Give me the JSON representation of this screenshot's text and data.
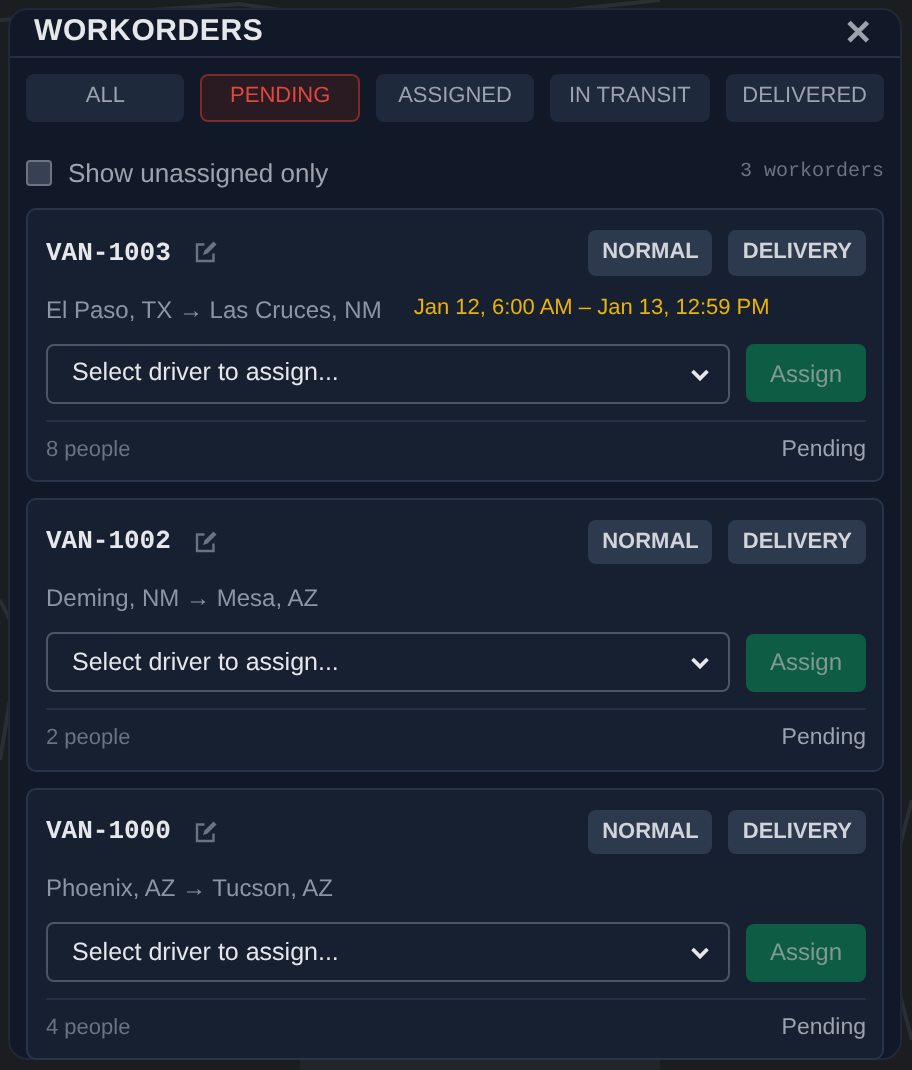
{
  "title": "WORKORDERS",
  "close": "✕",
  "tabs": [
    {
      "label": "ALL",
      "selected": false
    },
    {
      "label": "PENDING",
      "selected": true
    },
    {
      "label": "ASSIGNED",
      "selected": false
    },
    {
      "label": "IN TRANSIT",
      "selected": false
    },
    {
      "label": "DELIVERED",
      "selected": false
    }
  ],
  "filter": {
    "label": "Show unassigned only",
    "checked": false
  },
  "count": "3 workorders",
  "workorders": [
    {
      "id": "VAN-1003",
      "tags": [
        "NORMAL",
        "DELIVERY"
      ],
      "route": "El Paso, TX → Las Cruces, NM",
      "window": "Jan 12, 6:00 AM – Jan 13, 12:59 PM",
      "driver_placeholder": "Select driver to assign...",
      "assign": {
        "label": "Assign",
        "disabled": true
      },
      "people": "8 people",
      "status": "Pending"
    },
    {
      "id": "VAN-1002",
      "tags": [
        "NORMAL",
        "DELIVERY"
      ],
      "route": "Deming, NM → Mesa, AZ",
      "driver_placeholder": "Select driver to assign...",
      "assign": {
        "label": "Assign",
        "disabled": true
      },
      "people": "2 people",
      "status": "Pending"
    },
    {
      "id": "VAN-1000",
      "tags": [
        "NORMAL",
        "DELIVERY"
      ],
      "route": "Phoenix, AZ → Tucson, AZ",
      "driver_placeholder": "Select driver to assign...",
      "assign": {
        "label": "Assign",
        "disabled": true
      },
      "people": "4 people",
      "status": "Pending"
    }
  ]
}
